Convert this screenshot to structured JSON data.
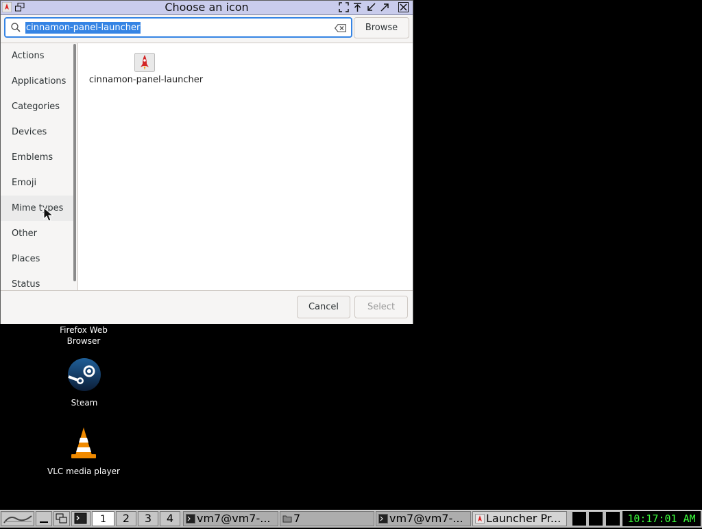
{
  "window": {
    "title": "Choose an icon"
  },
  "search": {
    "query": "cinnamon-panel-launcher",
    "browse_label": "Browse"
  },
  "categories": [
    "Actions",
    "Applications",
    "Categories",
    "Devices",
    "Emblems",
    "Emoji",
    "Mime types",
    "Other",
    "Places",
    "Status"
  ],
  "results": [
    {
      "label": "cinnamon-panel-launcher",
      "icon": "rocket-launcher-icon"
    }
  ],
  "footer": {
    "cancel_label": "Cancel",
    "select_label": "Select"
  },
  "desktop": {
    "firefox_label": "Firefox Web\nBrowser",
    "steam_label": "Steam",
    "vlc_label": "VLC media player"
  },
  "taskbar": {
    "menu_label": "icewm",
    "workspaces": [
      "1",
      "2",
      "3",
      "4"
    ],
    "tasks": [
      {
        "label": "vm7@vm7-...",
        "icon": "terminal-icon"
      },
      {
        "label": "7",
        "icon": "folder-icon"
      },
      {
        "label": "vm7@vm7-...",
        "icon": "terminal-icon"
      },
      {
        "label": "Launcher Pr...",
        "icon": "launcher-icon"
      }
    ],
    "clock": "10:17:01 AM"
  },
  "colors": {
    "accent": "#3584e4",
    "titlebar": "#c9ccec",
    "clock_text": "#3cff3c"
  }
}
